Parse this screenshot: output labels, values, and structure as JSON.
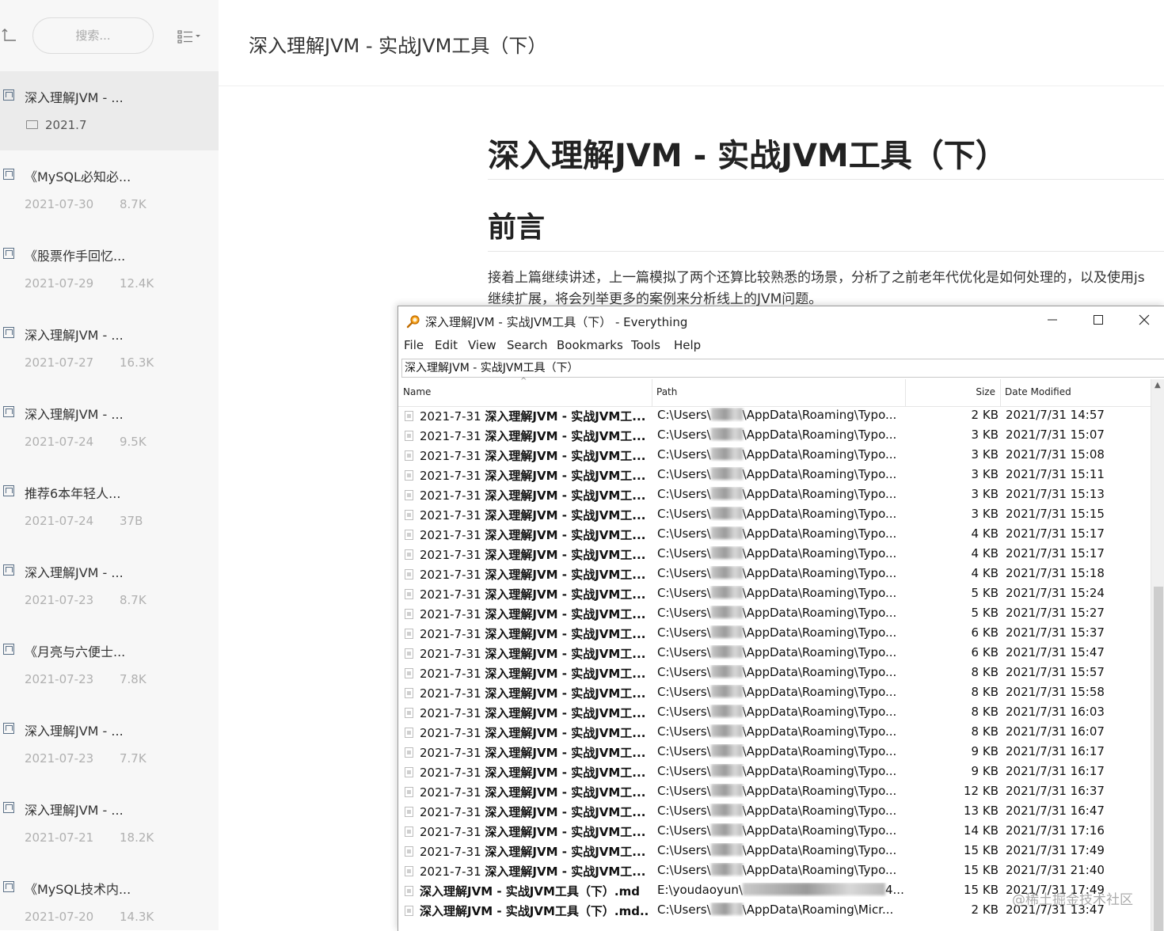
{
  "sidebar": {
    "search_placeholder": "搜索...",
    "items": [
      {
        "title": "深入理解JVM - ...",
        "folder": "2021.7",
        "active": true
      },
      {
        "title": "《MySQL必知必...",
        "date": "2021-07-30",
        "size": "8.7K"
      },
      {
        "title": "《股票作手回忆...",
        "date": "2021-07-29",
        "size": "12.4K"
      },
      {
        "title": "深入理解JVM - ...",
        "date": "2021-07-27",
        "size": "16.3K"
      },
      {
        "title": "深入理解JVM - ...",
        "date": "2021-07-24",
        "size": "9.5K"
      },
      {
        "title": "推荐6本年轻人...",
        "date": "2021-07-24",
        "size": "37B"
      },
      {
        "title": "深入理解JVM - ...",
        "date": "2021-07-23",
        "size": "8.7K"
      },
      {
        "title": "《月亮与六便士...",
        "date": "2021-07-23",
        "size": "7.8K"
      },
      {
        "title": "深入理解JVM - ...",
        "date": "2021-07-23",
        "size": "7.7K"
      },
      {
        "title": "深入理解JVM - ...",
        "date": "2021-07-21",
        "size": "18.2K"
      },
      {
        "title": "《MySQL技术内...",
        "date": "2021-07-20",
        "size": "14.3K"
      }
    ]
  },
  "document": {
    "header_title": "深入理解JVM - 实战JVM工具（下）",
    "h1": "深入理解JVM - 实战JVM工具（下）",
    "h2": "前言",
    "paragraph_line1": "接着上篇继续讲述，上一篇模拟了两个还算比较熟悉的场景，分析了之前老年代优化是如何处理的，以及使用js",
    "paragraph_line2": "继续扩展，将会列举更多的案例来分析线上的JVM问题。"
  },
  "everything": {
    "title": "深入理解JVM - 实战JVM工具（下） - Everything",
    "menus": [
      "File",
      "Edit",
      "View",
      "Search",
      "Bookmarks",
      "Tools",
      "Help"
    ],
    "search_value": "深入理解JVM - 实战JVM工具（下）",
    "columns": {
      "name": "Name",
      "path": "Path",
      "size": "Size",
      "date": "Date Modified"
    },
    "rows": [
      {
        "name_prefix": "2021-7-31 ",
        "name_bold": "深入理解JVM - 实战JVM工...",
        "path_start": "C:\\Users\\",
        "path_end": "\\AppData\\Roaming\\Typo...",
        "size": "2 KB",
        "date": "2021/7/31 14:57"
      },
      {
        "name_prefix": "2021-7-31 ",
        "name_bold": "深入理解JVM - 实战JVM工...",
        "path_start": "C:\\Users\\",
        "path_end": "\\AppData\\Roaming\\Typo...",
        "size": "3 KB",
        "date": "2021/7/31 15:07"
      },
      {
        "name_prefix": "2021-7-31 ",
        "name_bold": "深入理解JVM - 实战JVM工...",
        "path_start": "C:\\Users\\",
        "path_end": "\\AppData\\Roaming\\Typo...",
        "size": "3 KB",
        "date": "2021/7/31 15:08"
      },
      {
        "name_prefix": "2021-7-31 ",
        "name_bold": "深入理解JVM - 实战JVM工...",
        "path_start": "C:\\Users\\",
        "path_end": "\\AppData\\Roaming\\Typo...",
        "size": "3 KB",
        "date": "2021/7/31 15:11"
      },
      {
        "name_prefix": "2021-7-31 ",
        "name_bold": "深入理解JVM - 实战JVM工...",
        "path_start": "C:\\Users\\",
        "path_end": "\\AppData\\Roaming\\Typo...",
        "size": "3 KB",
        "date": "2021/7/31 15:13"
      },
      {
        "name_prefix": "2021-7-31 ",
        "name_bold": "深入理解JVM - 实战JVM工...",
        "path_start": "C:\\Users\\",
        "path_end": "\\AppData\\Roaming\\Typo...",
        "size": "3 KB",
        "date": "2021/7/31 15:15"
      },
      {
        "name_prefix": "2021-7-31 ",
        "name_bold": "深入理解JVM - 实战JVM工...",
        "path_start": "C:\\Users\\",
        "path_end": "\\AppData\\Roaming\\Typo...",
        "size": "4 KB",
        "date": "2021/7/31 15:17"
      },
      {
        "name_prefix": "2021-7-31 ",
        "name_bold": "深入理解JVM - 实战JVM工...",
        "path_start": "C:\\Users\\",
        "path_end": "\\AppData\\Roaming\\Typo...",
        "size": "4 KB",
        "date": "2021/7/31 15:17"
      },
      {
        "name_prefix": "2021-7-31 ",
        "name_bold": "深入理解JVM - 实战JVM工...",
        "path_start": "C:\\Users\\",
        "path_end": "\\AppData\\Roaming\\Typo...",
        "size": "4 KB",
        "date": "2021/7/31 15:18"
      },
      {
        "name_prefix": "2021-7-31 ",
        "name_bold": "深入理解JVM - 实战JVM工...",
        "path_start": "C:\\Users\\",
        "path_end": "\\AppData\\Roaming\\Typo...",
        "size": "5 KB",
        "date": "2021/7/31 15:24"
      },
      {
        "name_prefix": "2021-7-31 ",
        "name_bold": "深入理解JVM - 实战JVM工...",
        "path_start": "C:\\Users\\",
        "path_end": "\\AppData\\Roaming\\Typo...",
        "size": "5 KB",
        "date": "2021/7/31 15:27"
      },
      {
        "name_prefix": "2021-7-31 ",
        "name_bold": "深入理解JVM - 实战JVM工...",
        "path_start": "C:\\Users\\",
        "path_end": "\\AppData\\Roaming\\Typo...",
        "size": "6 KB",
        "date": "2021/7/31 15:37"
      },
      {
        "name_prefix": "2021-7-31 ",
        "name_bold": "深入理解JVM - 实战JVM工...",
        "path_start": "C:\\Users\\",
        "path_end": "\\AppData\\Roaming\\Typo...",
        "size": "6 KB",
        "date": "2021/7/31 15:47"
      },
      {
        "name_prefix": "2021-7-31 ",
        "name_bold": "深入理解JVM - 实战JVM工...",
        "path_start": "C:\\Users\\",
        "path_end": "\\AppData\\Roaming\\Typo...",
        "size": "8 KB",
        "date": "2021/7/31 15:57"
      },
      {
        "name_prefix": "2021-7-31 ",
        "name_bold": "深入理解JVM - 实战JVM工...",
        "path_start": "C:\\Users\\",
        "path_end": "\\AppData\\Roaming\\Typo...",
        "size": "8 KB",
        "date": "2021/7/31 15:58"
      },
      {
        "name_prefix": "2021-7-31 ",
        "name_bold": "深入理解JVM - 实战JVM工...",
        "path_start": "C:\\Users\\",
        "path_end": "\\AppData\\Roaming\\Typo...",
        "size": "8 KB",
        "date": "2021/7/31 16:03"
      },
      {
        "name_prefix": "2021-7-31 ",
        "name_bold": "深入理解JVM - 实战JVM工...",
        "path_start": "C:\\Users\\",
        "path_end": "\\AppData\\Roaming\\Typo...",
        "size": "8 KB",
        "date": "2021/7/31 16:07"
      },
      {
        "name_prefix": "2021-7-31 ",
        "name_bold": "深入理解JVM - 实战JVM工...",
        "path_start": "C:\\Users\\",
        "path_end": "\\AppData\\Roaming\\Typo...",
        "size": "9 KB",
        "date": "2021/7/31 16:17"
      },
      {
        "name_prefix": "2021-7-31 ",
        "name_bold": "深入理解JVM - 实战JVM工...",
        "path_start": "C:\\Users\\",
        "path_end": "\\AppData\\Roaming\\Typo...",
        "size": "9 KB",
        "date": "2021/7/31 16:17"
      },
      {
        "name_prefix": "2021-7-31 ",
        "name_bold": "深入理解JVM - 实战JVM工...",
        "path_start": "C:\\Users\\",
        "path_end": "\\AppData\\Roaming\\Typo...",
        "size": "12 KB",
        "date": "2021/7/31 16:37"
      },
      {
        "name_prefix": "2021-7-31 ",
        "name_bold": "深入理解JVM - 实战JVM工...",
        "path_start": "C:\\Users\\",
        "path_end": "\\AppData\\Roaming\\Typo...",
        "size": "13 KB",
        "date": "2021/7/31 16:47"
      },
      {
        "name_prefix": "2021-7-31 ",
        "name_bold": "深入理解JVM - 实战JVM工...",
        "path_start": "C:\\Users\\",
        "path_end": "\\AppData\\Roaming\\Typo...",
        "size": "14 KB",
        "date": "2021/7/31 17:16"
      },
      {
        "name_prefix": "2021-7-31 ",
        "name_bold": "深入理解JVM - 实战JVM工...",
        "path_start": "C:\\Users\\",
        "path_end": "\\AppData\\Roaming\\Typo...",
        "size": "15 KB",
        "date": "2021/7/31 17:49"
      },
      {
        "name_prefix": "2021-7-31 ",
        "name_bold": "深入理解JVM - 实战JVM工...",
        "path_start": "C:\\Users\\",
        "path_end": "\\AppData\\Roaming\\Typo...",
        "size": "15 KB",
        "date": "2021/7/31 21:40"
      },
      {
        "name_prefix": "",
        "name_bold": "深入理解JVM - 实战JVM工具（下）.md",
        "path_start": "E:\\youdaoyun\\",
        "path_end": "4...",
        "size": "15 KB",
        "date": "2021/7/31 17:49"
      },
      {
        "name_prefix": "",
        "name_bold": "深入理解JVM - 实战JVM工具（下）.md...",
        "path_start": "C:\\Users\\",
        "path_end": "\\AppData\\Roaming\\Micr...",
        "size": "2 KB",
        "date": "2021/7/31 13:47"
      }
    ]
  },
  "watermark": "@稀土掘金技术社区"
}
